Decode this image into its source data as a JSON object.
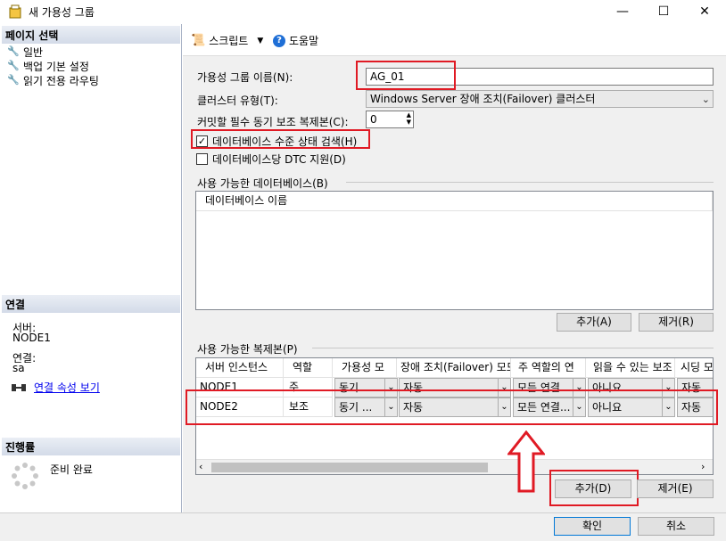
{
  "window": {
    "title": "새 가용성 그룹",
    "minimize": "—",
    "maximize": "☐",
    "close": "✕"
  },
  "sidebar": {
    "page_select_header": "페이지 선택",
    "items": [
      {
        "label": "일반"
      },
      {
        "label": "백업 기본 설정"
      },
      {
        "label": "읽기 전용 라우팅"
      }
    ],
    "connection_header": "연결",
    "server_label": "서버:",
    "server_value": "NODE1",
    "connection_label": "연결:",
    "connection_value": "sa",
    "view_props_link": "연결 속성 보기",
    "progress_header": "진행률",
    "progress_status": "준비 완료"
  },
  "toolbar": {
    "script_label": "스크립트",
    "help_label": "도움말"
  },
  "form": {
    "ag_name_label": "가용성 그룹 이름(N):",
    "ag_name_value": "AG_01",
    "cluster_type_label": "클러스터 유형(T):",
    "cluster_type_value": "Windows Server 장애 조치(Failover) 클러스터",
    "sync_replicas_label": "커밋할 필수 동기 보조 복제본(C):",
    "sync_replicas_value": "0",
    "db_health_label": "데이터베이스 수준 상태 검색(H)",
    "db_health_checked": true,
    "dtc_label": "데이터베이스당 DTC 지원(D)",
    "dtc_checked": false
  },
  "databases": {
    "group_label": "사용 가능한 데이터베이스(B)",
    "column_header": "데이터베이스 이름",
    "add_button": "추가(A)",
    "remove_button": "제거(R)"
  },
  "replicas": {
    "group_label": "사용 가능한 복제본(P)",
    "columns": [
      "서버 인스턴스",
      "역할",
      "가용성 모",
      "장애 조치(Failover) 모드",
      "주 역할의 연",
      "읽을 수 있는 보조",
      "시딩 모"
    ],
    "rows": [
      {
        "server": "NODE1",
        "role": "주",
        "avail": "동기",
        "failover": "자동",
        "primary_conn": "모든 연결",
        "readable": "아니요",
        "seeding": "자동"
      },
      {
        "server": "NODE2",
        "role": "보조",
        "avail": "동기 ...",
        "failover": "자동",
        "primary_conn": "모든 연결...",
        "readable": "아니요",
        "seeding": "자동"
      }
    ],
    "add_button": "추가(D)",
    "remove_button": "제거(E)"
  },
  "footer": {
    "ok_button": "확인",
    "cancel_button": "취소"
  },
  "colors": {
    "highlight": "#e01a24",
    "link": "#0000ee"
  }
}
